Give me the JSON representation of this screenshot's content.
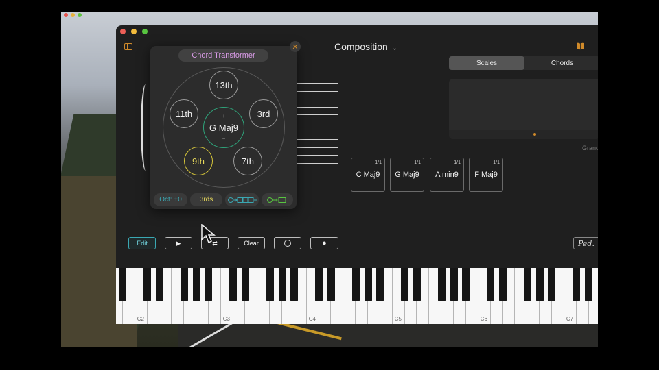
{
  "app": {
    "title": "Composition",
    "tabs": [
      {
        "label": "Scales",
        "active": true
      },
      {
        "label": "Chords",
        "active": false
      }
    ],
    "grand_label": "Grand"
  },
  "chord_transformer": {
    "title": "Chord Transformer",
    "center": "G Maj9",
    "center_plus": "+",
    "center_minus": "−",
    "nodes": {
      "n13": "13th",
      "n11": "11th",
      "n3": "3rd",
      "n9": "9th",
      "n7": "7th"
    },
    "chips": {
      "octave": "Oct: +0",
      "interval": "3rds"
    },
    "accent_colors": {
      "title": "#d89be6",
      "selected": "#d6c63a",
      "center": "#2fa37a",
      "octave": "#3aa8b3"
    }
  },
  "chords": [
    {
      "name": "C Maj9",
      "frac": "1/1"
    },
    {
      "name": "G Maj9",
      "frac": "1/1"
    },
    {
      "name": "A min9",
      "frac": "1/1"
    },
    {
      "name": "F Maj9",
      "frac": "1/1"
    }
  ],
  "transport": {
    "edit": "Edit",
    "play": "▶",
    "loop": "⇄",
    "clear": "Clear",
    "more": "⋯",
    "record": "●",
    "pedal": "Ped."
  },
  "keyboard": {
    "labels": [
      "C2",
      "C3",
      "C4",
      "C5",
      "C6",
      "C7"
    ]
  }
}
